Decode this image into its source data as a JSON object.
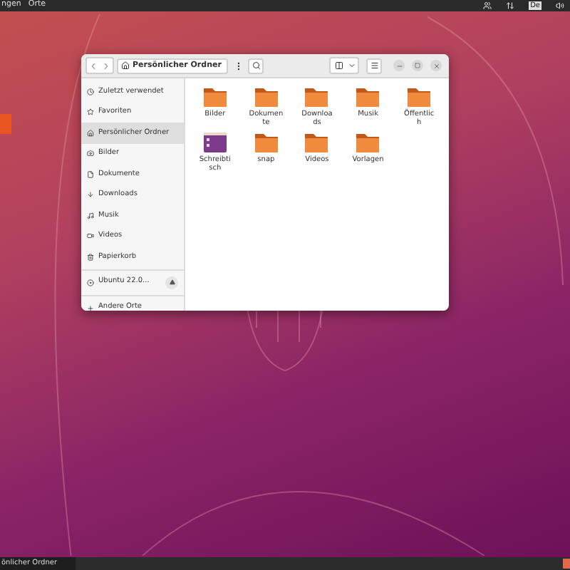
{
  "top_bar": {
    "menus": [
      "ngen",
      "Orte"
    ],
    "keyboard_layout": "De"
  },
  "window": {
    "path": "Persönlicher Ordner",
    "sidebar": {
      "items": [
        {
          "label": "Zuletzt verwendet",
          "selected": false
        },
        {
          "label": "Favoriten",
          "selected": false
        },
        {
          "label": "Persönlicher Ordner",
          "selected": true
        },
        {
          "label": "Bilder",
          "selected": false
        },
        {
          "label": "Dokumente",
          "selected": false
        },
        {
          "label": "Downloads",
          "selected": false
        },
        {
          "label": "Musik",
          "selected": false
        },
        {
          "label": "Videos",
          "selected": false
        },
        {
          "label": "Papierkorb",
          "selected": false
        }
      ],
      "drives": [
        {
          "label": "Ubuntu 22.0..."
        }
      ],
      "other": {
        "label": "Andere Orte"
      }
    },
    "files": [
      {
        "name": "Bilder",
        "kind": "folder"
      },
      {
        "name": "Dokumente",
        "kind": "folder"
      },
      {
        "name": "Downloads",
        "kind": "folder"
      },
      {
        "name": "Musik",
        "kind": "folder"
      },
      {
        "name": "Öffentlich",
        "kind": "folder"
      },
      {
        "name": "Schreibtisch",
        "kind": "desktop"
      },
      {
        "name": "snap",
        "kind": "folder"
      },
      {
        "name": "Videos",
        "kind": "folder"
      },
      {
        "name": "Vorlagen",
        "kind": "folder"
      }
    ]
  },
  "taskbar": {
    "window_title": "önlicher Ordner"
  }
}
